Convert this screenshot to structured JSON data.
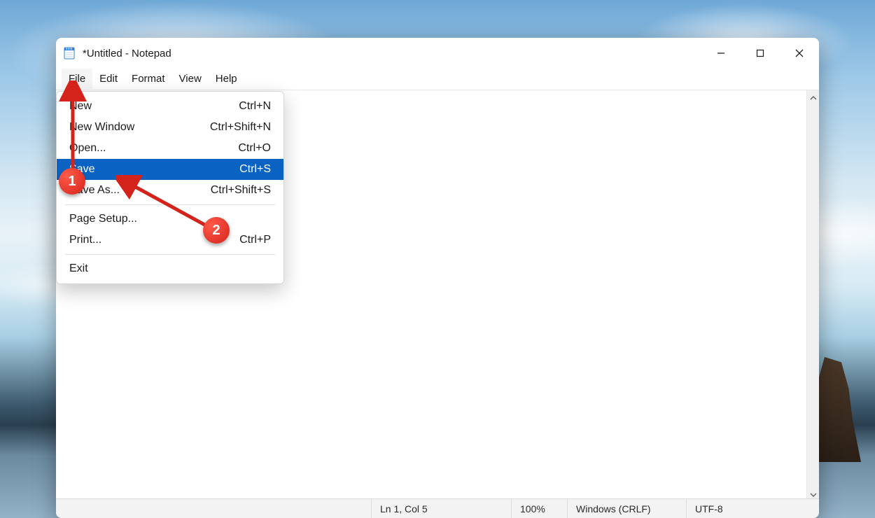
{
  "window": {
    "title": "*Untitled - Notepad"
  },
  "menubar": {
    "file": "File",
    "edit": "Edit",
    "format": "Format",
    "view": "View",
    "help": "Help"
  },
  "file_menu": {
    "new": {
      "label": "New",
      "shortcut": "Ctrl+N"
    },
    "new_window": {
      "label": "New Window",
      "shortcut": "Ctrl+Shift+N"
    },
    "open": {
      "label": "Open...",
      "shortcut": "Ctrl+O"
    },
    "save": {
      "label": "Save",
      "shortcut": "Ctrl+S"
    },
    "save_as": {
      "label": "Save As...",
      "shortcut": "Ctrl+Shift+S"
    },
    "page_setup": {
      "label": "Page Setup...",
      "shortcut": ""
    },
    "print": {
      "label": "Print...",
      "shortcut": "Ctrl+P"
    },
    "exit": {
      "label": "Exit",
      "shortcut": ""
    }
  },
  "statusbar": {
    "position": "Ln 1, Col 5",
    "zoom": "100%",
    "line_ending": "Windows (CRLF)",
    "encoding": "UTF-8"
  },
  "annotations": {
    "badge1": "1",
    "badge2": "2"
  }
}
